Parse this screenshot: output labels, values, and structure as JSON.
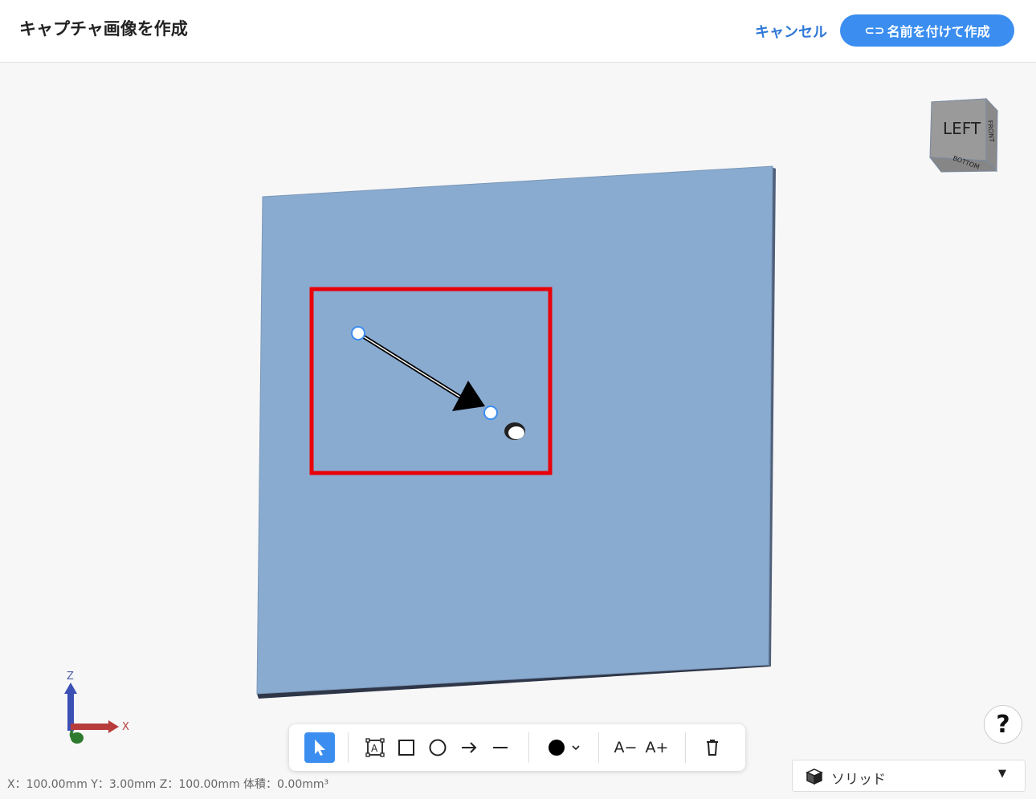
{
  "header": {
    "title": "キャプチャ画像を作成",
    "cancel_label": "キャンセル",
    "create_label": "名前を付けて作成"
  },
  "viewcube": {
    "front_face": "LEFT",
    "right_face": "FRONT",
    "bottom_face": "BOTTOM"
  },
  "axes": {
    "z_label": "Z",
    "x_label": "X"
  },
  "toolbar": {
    "tools": [
      "select",
      "text-box",
      "rectangle",
      "circle",
      "arrow",
      "line",
      "color",
      "font-smaller",
      "font-larger",
      "delete"
    ],
    "font_smaller_label": "A−",
    "font_larger_label": "A+",
    "current_color": "#000000"
  },
  "status_text": "X：100.00mm Y：3.00mm Z：100.00mm 体積：0.00mm³",
  "help_label": "?",
  "display_mode": {
    "label": "ソリッド"
  },
  "colors": {
    "accent": "#3b8ef0",
    "plate": "#8aabd0",
    "annotation_rect": "#e8000a"
  }
}
